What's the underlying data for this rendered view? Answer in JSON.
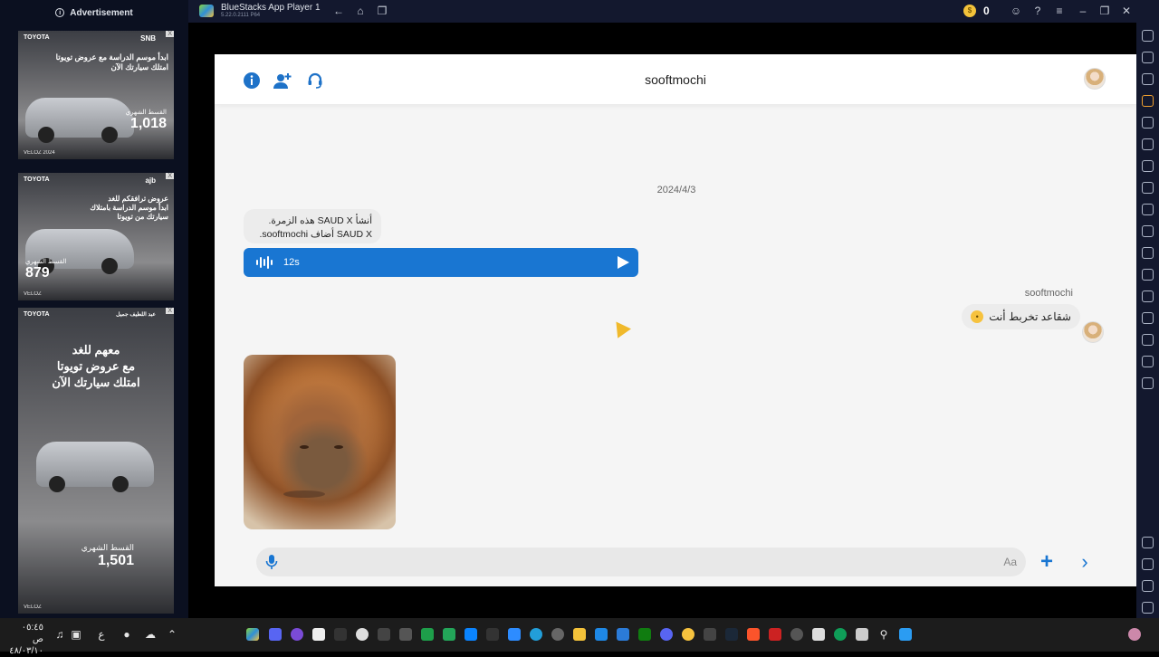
{
  "ads": {
    "header_label": "Advertisement",
    "items": [
      {
        "brand": "TOYOTA",
        "bank": "SNB",
        "adx": "X",
        "headline": "ابدأ موسم الدراسة مع عروض تويوتا\nامتلك سيارتك الآن",
        "price_label": "القسط الشهري",
        "price": "1,018",
        "model": "VELOZ 2024"
      },
      {
        "brand": "TOYOTA",
        "bank": "ajb",
        "adx": "X",
        "headline": "عروض ترافقكم للغد\nابدأ موسم الدراسة بامتلاك\nسيارتك من تويوتا",
        "price_label": "القسط الشهري",
        "price": "879",
        "model": "VELOZ"
      },
      {
        "brand": "TOYOTA",
        "bank": "عبد اللطيف جميل",
        "adx": "X",
        "headline": "معهم للغد\nمع عروض تويوتا\nامتلك سيارتك الآن",
        "price_label": "القسط الشهري",
        "price": "1,501",
        "model": "VELOZ"
      }
    ]
  },
  "titlebar": {
    "title": "BlueStacks App Player 1",
    "version": "5.22.0.2111  P64",
    "coins": "0"
  },
  "chat": {
    "title": "sooftmochi",
    "date": "2024/4/3",
    "system_line1": "أنشأ SAUD X هذه الزمرة.",
    "system_line2": "SAUD X أضاف sooftmochi.",
    "audio_duration": "12s",
    "sender_name": "sooftmochi",
    "my_message": "شقاعد تخربط أنت",
    "composer_placeholder": "Aa"
  },
  "taskbar": {
    "time": "٠٥:٤٥ ص",
    "date": "٤٨/٠٣/١٠",
    "lang": "ع"
  },
  "colors": {
    "accent": "#1976d2",
    "chrome": "#13182e",
    "bubble": "#ececec"
  }
}
